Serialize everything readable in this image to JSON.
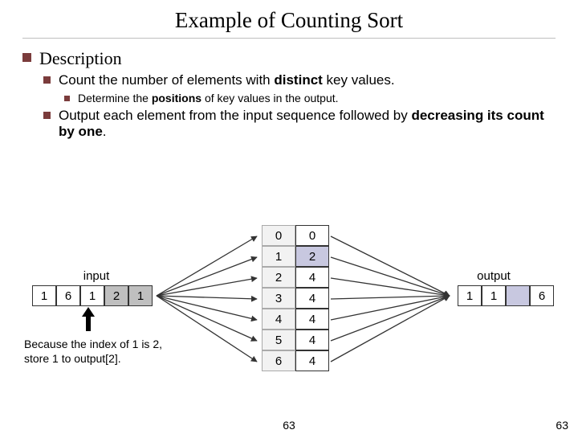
{
  "title": "Example of Counting Sort",
  "section": "Description",
  "bullets": {
    "b1_pre": "Count the number of elements with ",
    "b1_bold": "distinct",
    "b1_post": " key values.",
    "b1a_pre": "Determine the ",
    "b1a_bold": "positions",
    "b1a_post": " of key values in the output.",
    "b2_pre": "Output each element from the input sequence followed by ",
    "b2_bold": "decreasing its count by one",
    "b2_post": "."
  },
  "labels": {
    "input": "input",
    "output": "output"
  },
  "input": [
    "1",
    "6",
    "1",
    "2",
    "1"
  ],
  "input_grey_cols": [
    3,
    4
  ],
  "count_table": [
    {
      "idx": "0",
      "val": "0"
    },
    {
      "idx": "1",
      "val": "2"
    },
    {
      "idx": "2",
      "val": "4"
    },
    {
      "idx": "3",
      "val": "4"
    },
    {
      "idx": "4",
      "val": "4"
    },
    {
      "idx": "5",
      "val": "4"
    },
    {
      "idx": "6",
      "val": "4"
    }
  ],
  "count_hl_row": 1,
  "output": [
    "1",
    "1",
    "",
    "6"
  ],
  "output_lav_cols": [
    2
  ],
  "caption": "Because the index of 1 is 2, store 1 to output[2].",
  "page": "63"
}
